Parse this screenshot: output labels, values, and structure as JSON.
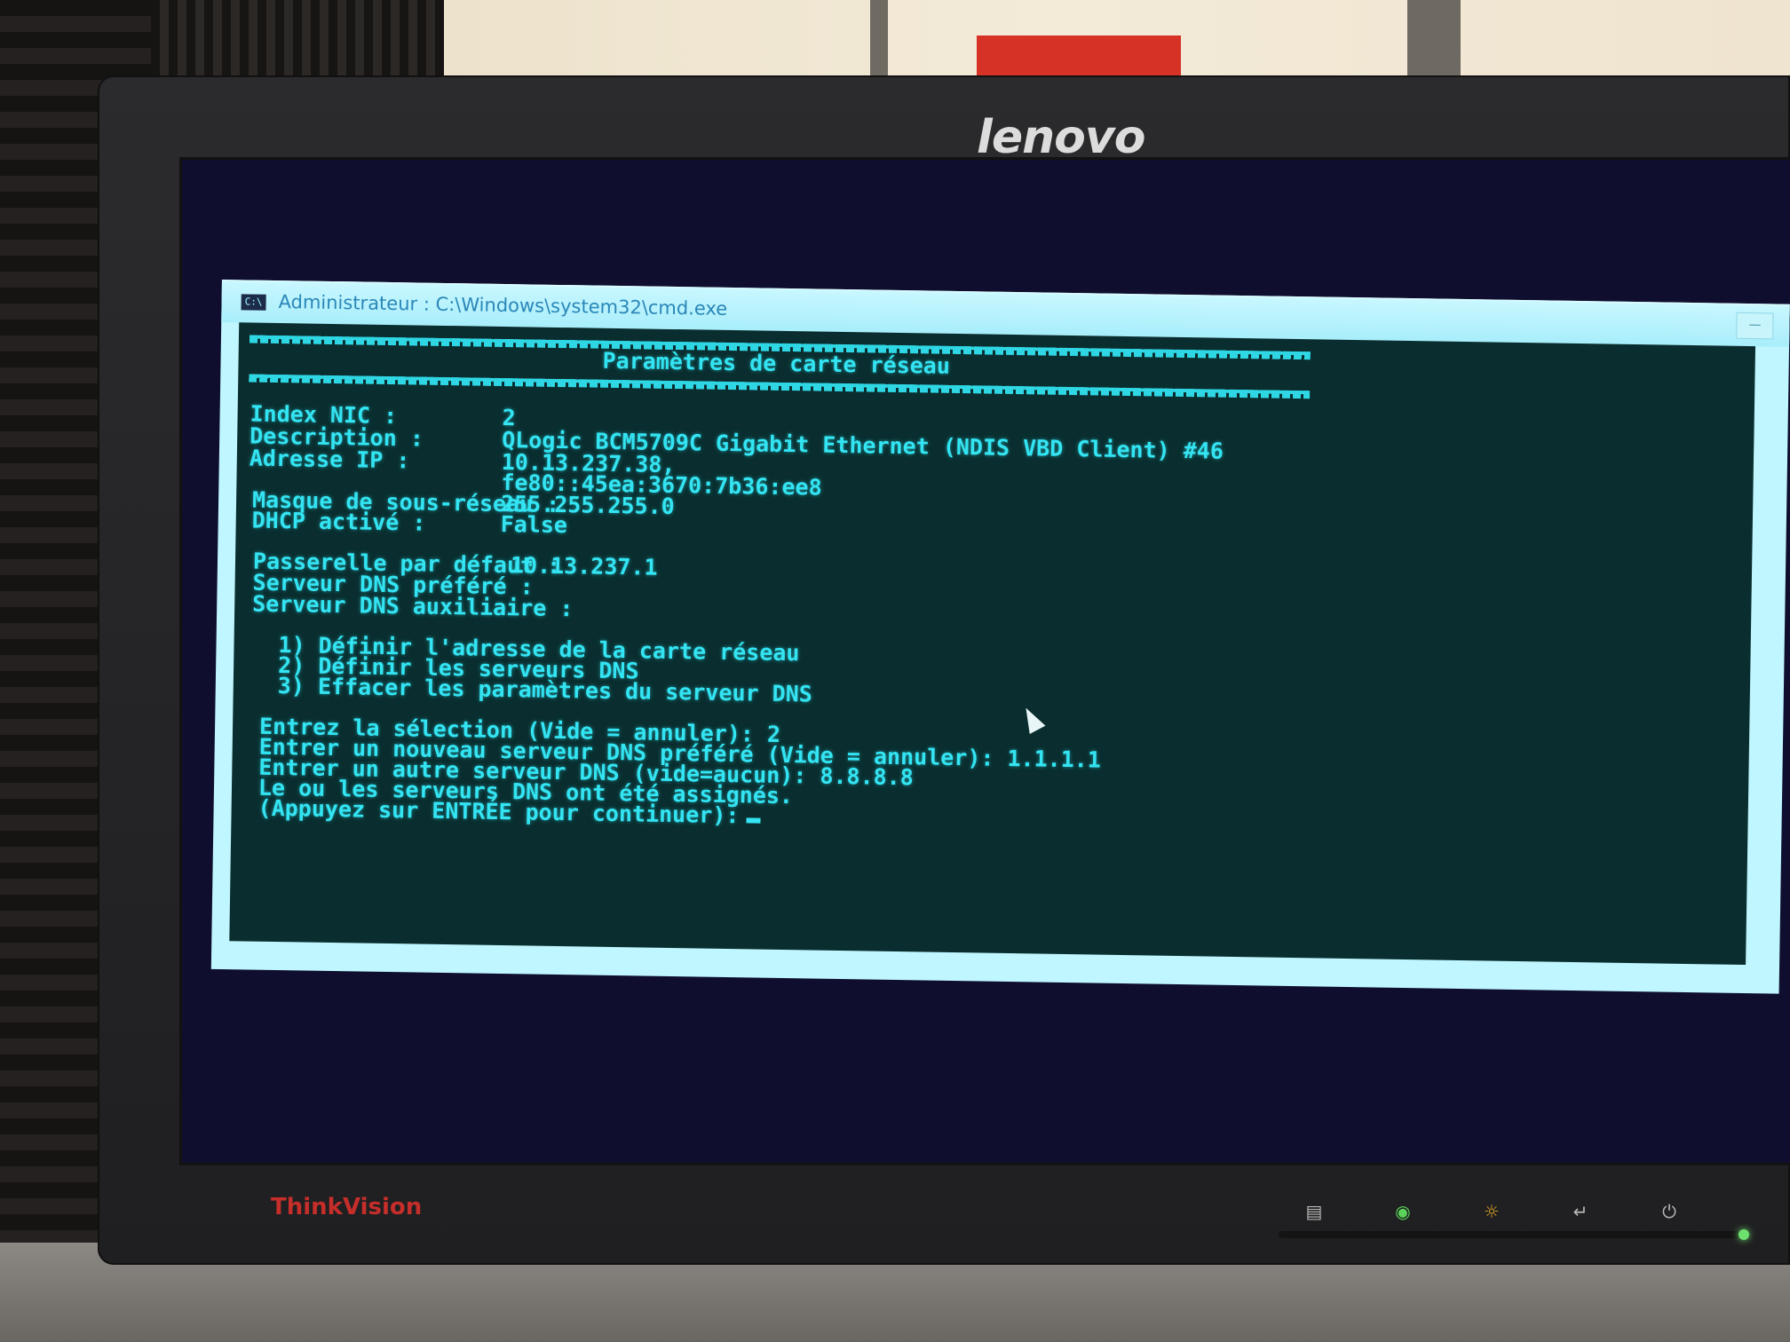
{
  "monitor": {
    "brand": "lenovo",
    "model": "ThinkVision"
  },
  "window": {
    "title": "Administrateur : C:\\Windows\\system32\\cmd.exe",
    "icon": "console-icon"
  },
  "console": {
    "header_title": "Paramètres de carte réseau",
    "fields": [
      {
        "label": "Index NIC :",
        "value": "2"
      },
      {
        "label": "Description :",
        "value": "QLogic BCM5709C Gigabit Ethernet (NDIS VBD Client) #46"
      },
      {
        "label": "Adresse IP :",
        "value": "10.13.237.38,"
      },
      {
        "label": "",
        "value": "fe80::45ea:3670:7b36:ee8"
      },
      {
        "label": "Masque de sous-réseau :",
        "value": "255.255.255.0"
      },
      {
        "label": "DHCP activé :",
        "value": "False"
      }
    ],
    "gateway_label": "Passerelle par défaut :",
    "gateway_value": "10.13.237.1",
    "dns_preferred_label": "Serveur DNS préféré :",
    "dns_aux_label": "Serveur DNS auxiliaire :",
    "menu": [
      "1) Définir l'adresse de la carte réseau",
      "2) Définir les serveurs DNS",
      "3) Effacer les paramètres du serveur DNS"
    ],
    "prompts": [
      "Entrez la sélection (Vide = annuler): 2",
      "Entrer un nouveau serveur DNS préféré (Vide = annuler): 1.1.1.1",
      "Entrer un autre serveur DNS (vide=aucun): 8.8.8.8",
      "Le ou les serveurs DNS ont été assignés.",
      "(Appuyez sur ENTRÉE pour continuer):"
    ]
  },
  "colors": {
    "console_bg": "#0a2e2f",
    "console_text": "#33e4f2",
    "titlebar": "#bff6ff",
    "brand_red": "#c52e2a"
  }
}
